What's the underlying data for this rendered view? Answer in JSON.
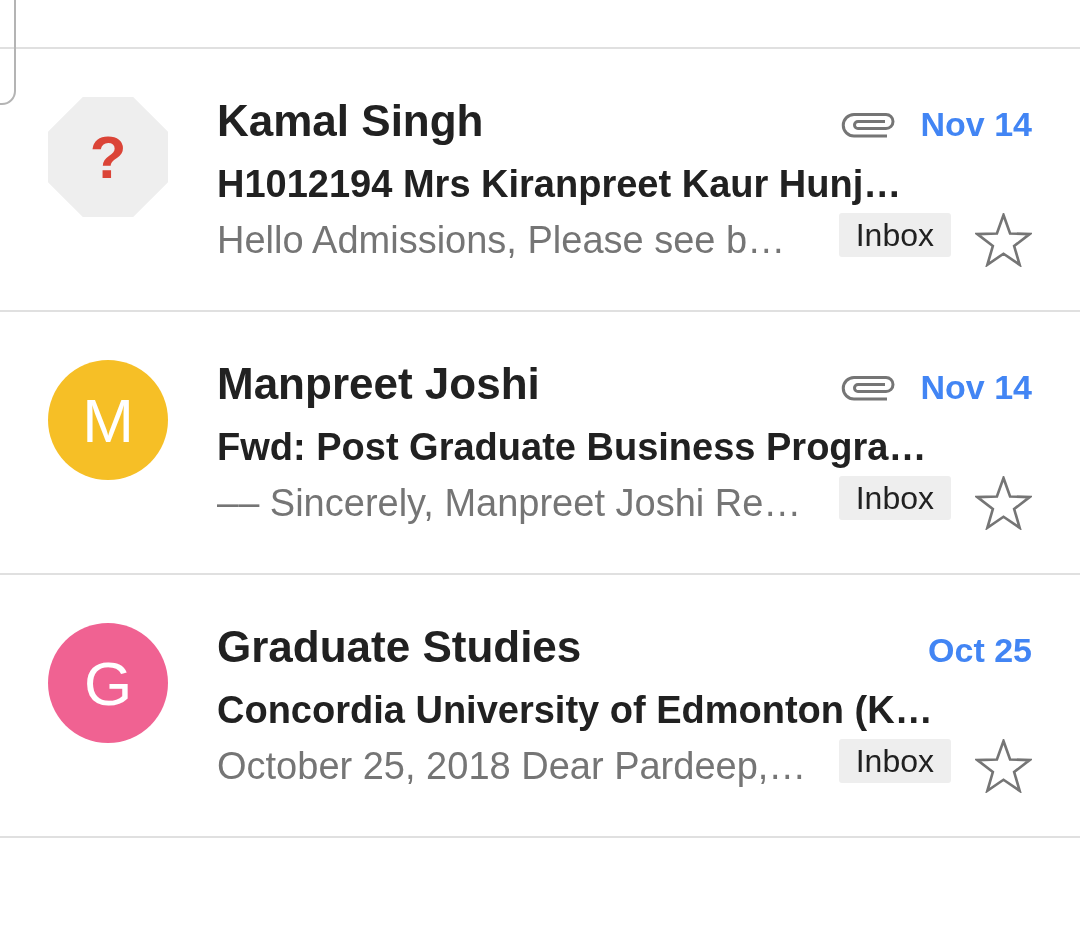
{
  "emails": [
    {
      "sender": "Kamal Singh",
      "avatar": {
        "kind": "unknown",
        "symbol": "?"
      },
      "unread": true,
      "has_attachment": true,
      "date": "Nov 14",
      "subject": "H1012194 Mrs Kiranpreet Kaur Hunj…",
      "snippet": "Hello Admissions, Please see b…",
      "label": "Inbox",
      "starred": false
    },
    {
      "sender": "Manpreet Joshi",
      "avatar": {
        "kind": "letter",
        "letter": "M",
        "color": "#f6bf26"
      },
      "unread": true,
      "has_attachment": true,
      "date": "Nov 14",
      "subject": "Fwd: Post Graduate Business Progra…",
      "snippet": "–– Sincerely, Manpreet Joshi Re…",
      "label": "Inbox",
      "starred": false
    },
    {
      "sender": "Graduate Studies",
      "avatar": {
        "kind": "letter",
        "letter": "G",
        "color": "#f06292"
      },
      "unread": true,
      "has_attachment": false,
      "date": "Oct 25",
      "subject": "Concordia University of Edmonton (K…",
      "snippet": "October 25, 2018 Dear Pardeep,…",
      "label": "Inbox",
      "starred": false
    }
  ]
}
